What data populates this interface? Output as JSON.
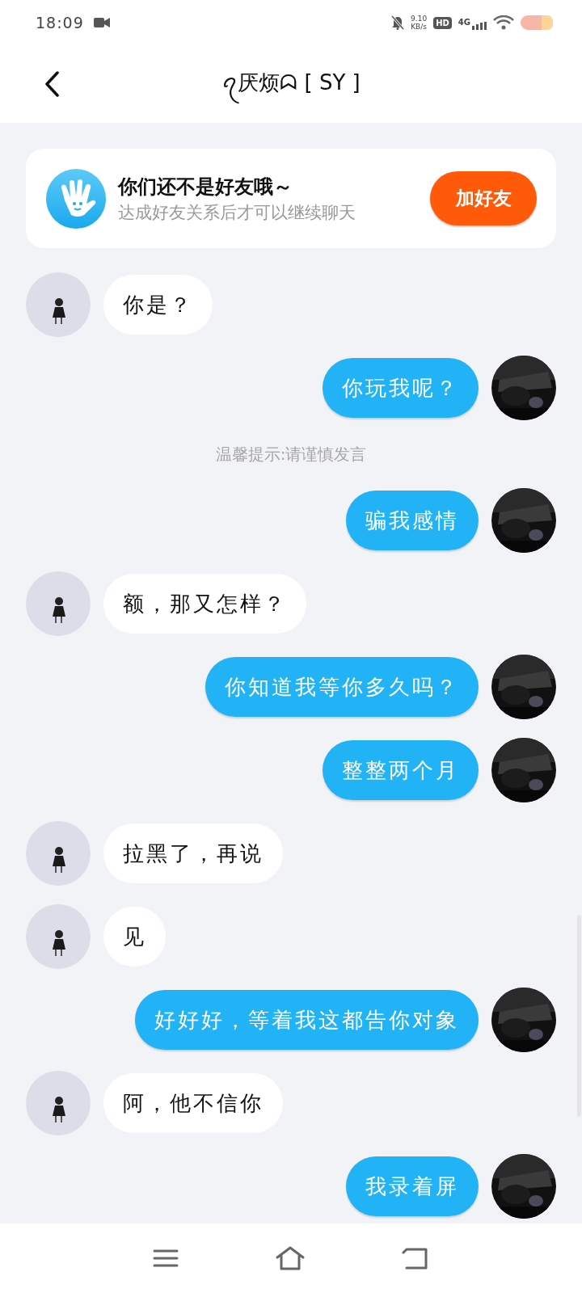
{
  "status_bar": {
    "time": "18:09",
    "net_speed": "9.10",
    "net_unit": "KB/s",
    "hd_badge": "HD",
    "network": "4G"
  },
  "header": {
    "title": "ꪖ厌烦ᗣ [ SY ]"
  },
  "friend_notice": {
    "title": "你们还不是好友哦～",
    "subtitle": "达成好友关系后才可以继续聊天",
    "button": "加好友"
  },
  "messages": [
    {
      "kind": "received",
      "text": "你是？"
    },
    {
      "kind": "sent",
      "text": "你玩我呢？"
    },
    {
      "kind": "tip",
      "text": "温馨提示:请谨慎发言"
    },
    {
      "kind": "sent",
      "text": "骗我感情"
    },
    {
      "kind": "received",
      "text": "额，那又怎样？"
    },
    {
      "kind": "sent",
      "text": "你知道我等你多久吗？"
    },
    {
      "kind": "sent",
      "text": "整整两个月"
    },
    {
      "kind": "received",
      "text": "拉黑了，再说"
    },
    {
      "kind": "received",
      "text": "见"
    },
    {
      "kind": "sent",
      "text": "好好好，等着我这都告你对象"
    },
    {
      "kind": "received",
      "text": "阿，他不信你"
    },
    {
      "kind": "sent",
      "text": "我录着屏"
    }
  ]
}
